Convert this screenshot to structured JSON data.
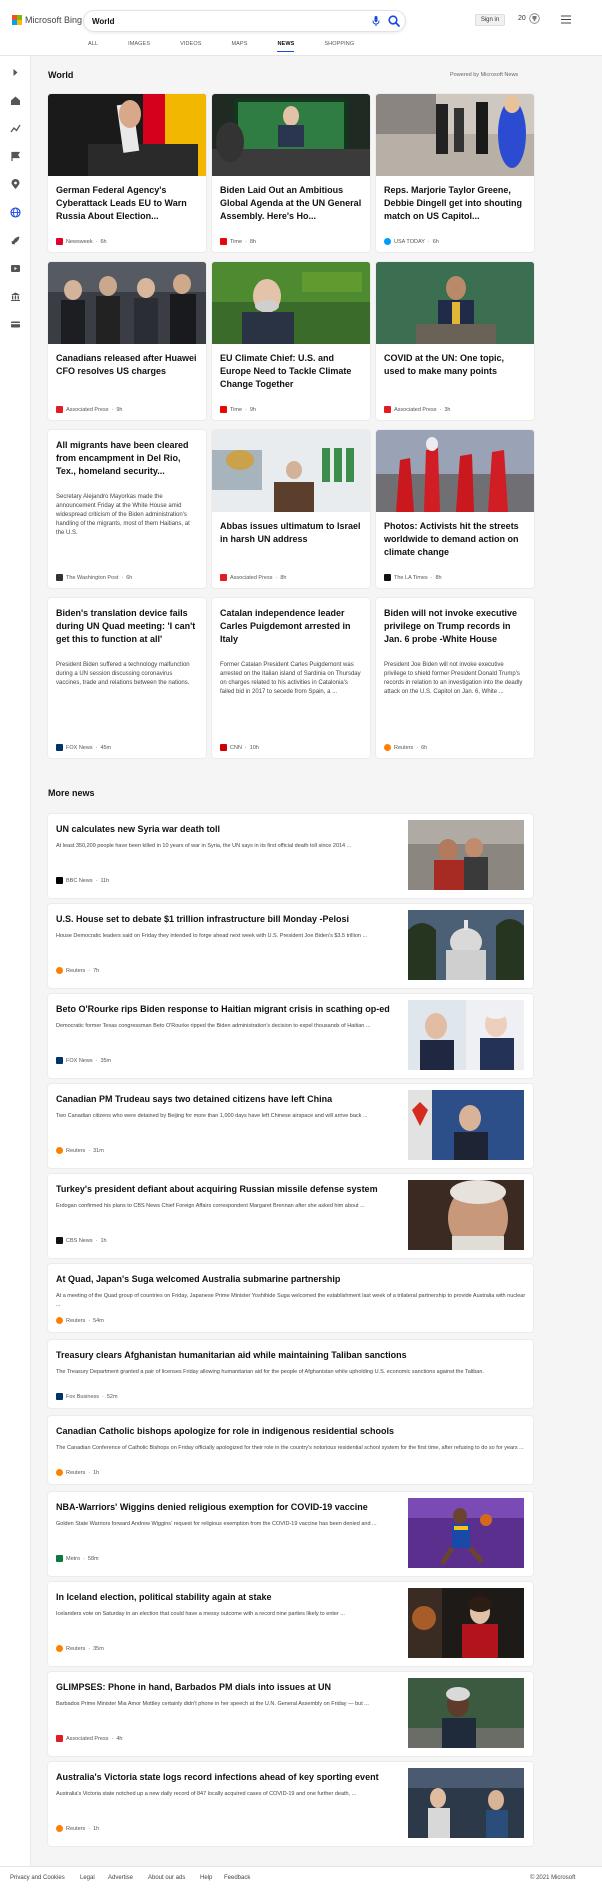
{
  "brand": {
    "name": "Microsoft Bing",
    "logo_colors": [
      "#f25022",
      "#7fba00",
      "#00a4ef",
      "#ffb900"
    ]
  },
  "search": {
    "query": "World"
  },
  "header": {
    "signin_label": "Sign in",
    "rewards_count": "20"
  },
  "tabs": [
    {
      "label": "All"
    },
    {
      "label": "Images"
    },
    {
      "label": "Videos"
    },
    {
      "label": "Maps"
    },
    {
      "label": "News"
    },
    {
      "label": "Shopping"
    }
  ],
  "section": {
    "title": "World",
    "powered": "Powered by Microsoft News"
  },
  "cards": [
    {
      "title": "German Federal Agency's Cyberattack Leads EU to Warn Russia About Election...",
      "source": "Newsweek",
      "age": "6h",
      "source_color": "#e4002b"
    },
    {
      "title": "Biden Laid Out an Ambitious Global Agenda at the UN General Assembly. Here's Ho...",
      "source": "Time",
      "age": "8h",
      "source_color": "#e90606"
    },
    {
      "title": "Reps. Marjorie Taylor Greene, Debbie Dingell get into shouting match on US Capitol...",
      "source": "USA TODAY",
      "age": "6h",
      "source_color": "#009bff"
    },
    {
      "title": "Canadians released after Huawei CFO resolves US charges",
      "source": "Associated Press",
      "age": "9h",
      "source_color": "#e31b23"
    },
    {
      "title": "EU Climate Chief: U.S. and Europe Need to Tackle Climate Change Together",
      "source": "Time",
      "age": "9h",
      "source_color": "#e90606"
    },
    {
      "title": "COVID at the UN: One topic, used to make many points",
      "source": "Associated Press",
      "age": "3h",
      "source_color": "#e31b23"
    },
    {
      "title": "All migrants have been cleared from encampment in Del Rio, Tex., homeland security...",
      "snippet": "Secretary Alejandro Mayorkas made the announcement Friday at the White House amid widespread criticism of the Biden administration's handling of the migrants, most of them Haitians, at the U.S.",
      "source": "The Washington Post",
      "age": "6h",
      "source_color": "#333333"
    },
    {
      "title": "Abbas issues ultimatum to Israel in harsh UN address",
      "source": "Associated Press",
      "age": "8h",
      "source_color": "#e31b23"
    },
    {
      "title": "Photos: Activists hit the streets worldwide to demand action on climate change",
      "source": "The LA Times",
      "age": "8h",
      "source_color": "#111111"
    },
    {
      "title": "Biden's translation device fails during UN Quad meeting: 'I can't get this to function at all'",
      "snippet": "President Biden suffered a technology malfunction during a UN session discussing coronavirus vaccines, trade and relations between the nations.",
      "source": "FOX News",
      "age": "45m",
      "source_color": "#003366"
    },
    {
      "title": "Catalan independence leader Carles Puigdemont arrested in Italy",
      "snippet": "Former Catalan President Carles Puigdemont was arrested on the Italian island of Sardinia on Thursday on charges related to his activities in Catalonia's failed bid in 2017 to secede from Spain, a ...",
      "source": "CNN",
      "age": "10h",
      "source_color": "#cc0000"
    },
    {
      "title": "Biden will not invoke executive privilege on Trump records in Jan. 6 probe -White House",
      "snippet": "President Joe Biden will not invoke executive privilege to shield former President Donald Trump's records in relation to an investigation into the deadly attack on the U.S. Capitol on Jan. 6, White ...",
      "source": "Reuters",
      "age": "6h",
      "source_color": "#ff8000"
    }
  ],
  "more_news": {
    "title": "More news",
    "items": [
      {
        "title": "UN calculates new Syria war death toll",
        "snippet": "At least 350,209 people have been killed in 10 years of war in Syria, the UN says in its first official death toll since 2014 ...",
        "source": "BBC News",
        "age": "11h",
        "source_color": "#000000",
        "has_image": true
      },
      {
        "title": "U.S. House set to debate $1 trillion infrastructure bill Monday -Pelosi",
        "snippet": "House Democratic leaders said on Friday they intended to forge ahead next week with U.S. President Joe Biden's $3.5 trillion ...",
        "source": "Reuters",
        "age": "7h",
        "source_color": "#ff8000",
        "has_image": true
      },
      {
        "title": "Beto O'Rourke rips Biden response to Haitian migrant crisis in scathing op-ed",
        "snippet": "Democratic former Texas congressman Beto O'Rourke ripped the Biden administration's decision to expel thousands of Haitian ...",
        "source": "FOX News",
        "age": "35m",
        "source_color": "#003366",
        "has_image": true
      },
      {
        "title": "Canadian PM Trudeau says two detained citizens have left China",
        "snippet": "Two Canadian citizens who were detained by Beijing for more than 1,000 days have left Chinese airspace and will arrive back ...",
        "source": "Reuters",
        "age": "31m",
        "source_color": "#ff8000",
        "has_image": true
      },
      {
        "title": "Turkey's president defiant about acquiring Russian missile defense system",
        "snippet": "Erdogan confirmed his plans to CBS News Chief Foreign Affairs correspondent Margaret Brennan after she asked him about ...",
        "source": "CBS News",
        "age": "1h",
        "source_color": "#111111",
        "has_image": true
      },
      {
        "title": "At Quad, Japan's Suga welcomed Australia submarine partnership",
        "snippet": "At a meeting of the Quad group of countries on Friday, Japanese Prime Minister Yoshihide Suga welcomed the establishment last week of a trilateral partnership to provide Australia with nuclear ...",
        "source": "Reuters",
        "age": "54m",
        "source_color": "#ff8000",
        "has_image": false
      },
      {
        "title": "Treasury clears Afghanistan humanitarian aid while maintaining Taliban sanctions",
        "snippet": "The Treasury Department granted a pair of licenses Friday allowing humanitarian aid for the people of Afghanistan while upholding U.S. economic sanctions against the Taliban.",
        "source": "Fox Business",
        "age": "52m",
        "source_color": "#003366",
        "has_image": false
      },
      {
        "title": "Canadian Catholic bishops apologize for role in indigenous residential schools",
        "snippet": "The Canadian Conference of Catholic Bishops on Friday officially apologized for their role in the country's notorious residential school system for the first time, after refusing to do so for years ...",
        "source": "Reuters",
        "age": "1h",
        "source_color": "#ff8000",
        "has_image": false
      },
      {
        "title": "NBA-Warriors' Wiggins denied religious exemption for COVID-19 vaccine",
        "snippet": "Golden State Warriors forward Andrew Wiggins' request for religious exemption from the COVID-19 vaccine has been denied and ...",
        "source": "Metro",
        "age": "58m",
        "source_color": "#0a7a3e",
        "has_image": true
      },
      {
        "title": "In Iceland election, political stability again at stake",
        "snippet": "Icelanders vote on Saturday in an election that could have a messy outcome with a record nine parties likely to enter ...",
        "source": "Reuters",
        "age": "35m",
        "source_color": "#ff8000",
        "has_image": true
      },
      {
        "title": "GLIMPSES: Phone in hand, Barbados PM dials into issues at UN",
        "snippet": "Barbados Prime Minister Mia Amor Mottley certainly didn't phone in her speech at the U.N. General Assembly on Friday — but ...",
        "source": "Associated Press",
        "age": "4h",
        "source_color": "#e31b23",
        "has_image": true
      },
      {
        "title": "Australia's Victoria state logs record infections ahead of key sporting event",
        "snippet": "Australia's Victoria state notched up a new daily record of 847 locally acquired cases of COVID-19 and one further death, ...",
        "source": "Reuters",
        "age": "1h",
        "source_color": "#ff8000",
        "has_image": true
      }
    ]
  },
  "footer": {
    "links": [
      "Privacy and Cookies",
      "Legal",
      "Advertise",
      "About our ads",
      "Help",
      "Feedback"
    ],
    "copyright": "© 2021 Microsoft"
  },
  "accent_color": "#174ae4"
}
